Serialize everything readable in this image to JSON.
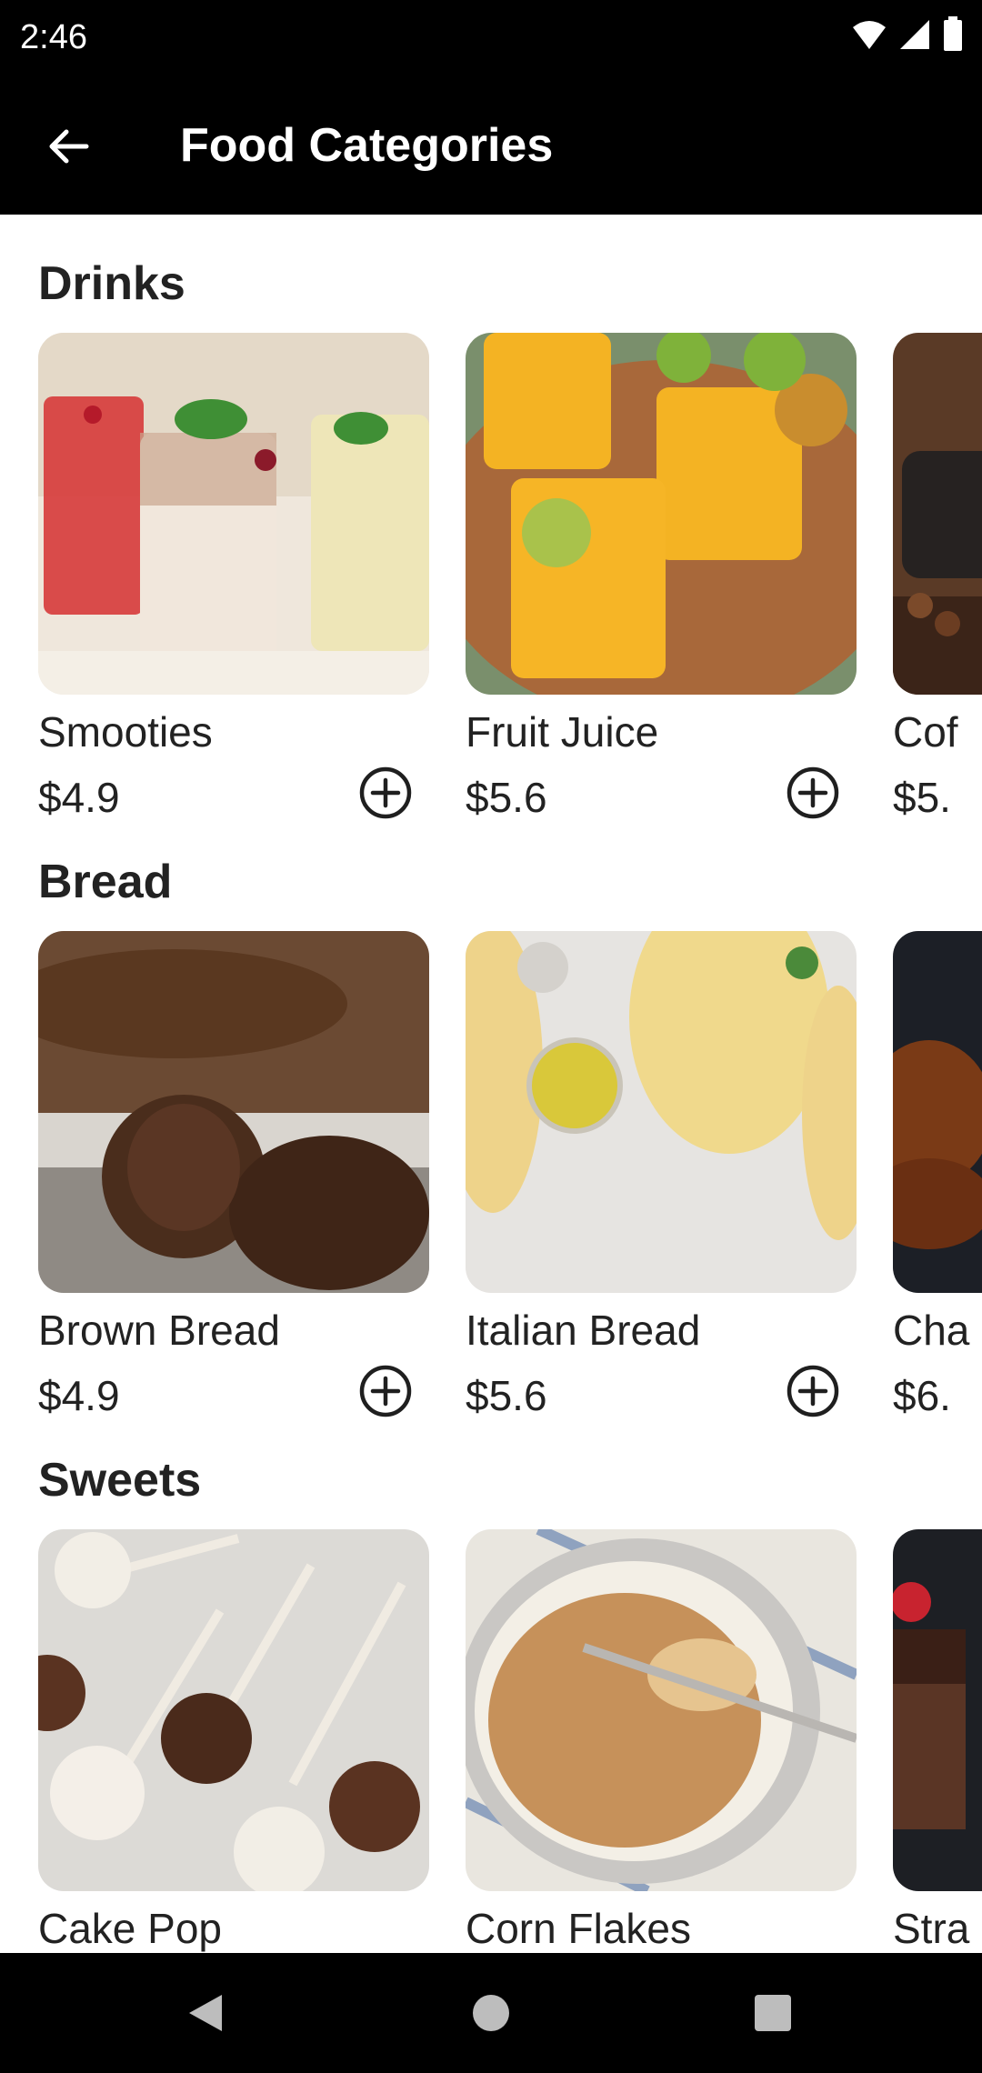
{
  "status_bar": {
    "time": "2:46",
    "icons": [
      "wifi-icon",
      "cellular-signal-icon",
      "battery-icon"
    ]
  },
  "app_bar": {
    "title": "Food Categories",
    "back_icon": "arrow-back-icon"
  },
  "sections": [
    {
      "title": "Drinks",
      "items": [
        {
          "name": "Smooties",
          "price": "$4.9",
          "image": "smoothies-photo"
        },
        {
          "name": "Fruit Juice",
          "price": "$5.6",
          "image": "fruit-juice-photo"
        },
        {
          "name": "Cof",
          "price": "$5.",
          "image": "coffee-photo"
        }
      ]
    },
    {
      "title": "Bread",
      "items": [
        {
          "name": "Brown Bread",
          "price": "$4.9",
          "image": "brown-bread-photo"
        },
        {
          "name": "Italian Bread",
          "price": "$5.6",
          "image": "italian-bread-photo"
        },
        {
          "name": "Cha",
          "price": "$6.",
          "image": "challah-photo"
        }
      ]
    },
    {
      "title": "Sweets",
      "items": [
        {
          "name": "Cake Pop",
          "price": "",
          "image": "cake-pop-photo"
        },
        {
          "name": "Corn Flakes",
          "price": "",
          "image": "corn-flakes-photo"
        },
        {
          "name": "Stra",
          "price": "",
          "image": "strawberry-cake-photo"
        }
      ]
    }
  ],
  "add_icon": "add-circle-icon",
  "nav_bar": {
    "buttons": [
      "back-triangle-icon",
      "home-circle-icon",
      "recents-square-icon"
    ]
  }
}
